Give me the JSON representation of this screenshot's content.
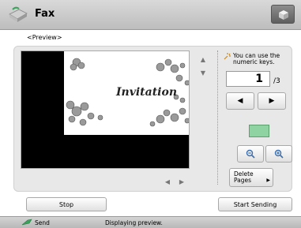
{
  "header": {
    "title": "Fax"
  },
  "subtitle": "<Preview>",
  "preview": {
    "document_text": "Invitation"
  },
  "side": {
    "hint": "You can use the numeric keys.",
    "page_current": "1",
    "page_total": "/3",
    "delete_pages": "Delete Pages"
  },
  "footer": {
    "stop_label": "Stop",
    "start_label": "Start Sending"
  },
  "status": {
    "mode": "Send",
    "message": "Displaying preview."
  },
  "colors": {
    "accent_green": "#8fd3a2",
    "panel": "#e8e8e8"
  }
}
